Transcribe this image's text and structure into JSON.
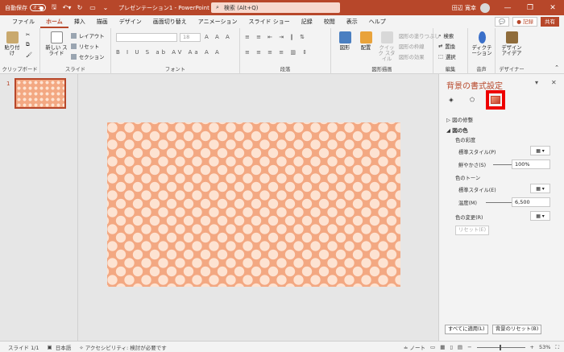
{
  "titlebar": {
    "autosave_label": "自動保存",
    "autosave_state": "オフ",
    "doc_title": "プレゼンテーション1 - PowerPoint",
    "search_placeholder": "検索 (Alt+Q)",
    "user_name": "田辺 寛幸"
  },
  "menu": {
    "tabs": [
      "ファイル",
      "ホーム",
      "挿入",
      "描画",
      "デザイン",
      "画面切り替え",
      "アニメーション",
      "スライド ショー",
      "記録",
      "校閲",
      "表示",
      "ヘルプ"
    ],
    "active": "ホーム",
    "record_label": "● 記録",
    "share_label": "共有"
  },
  "ribbon": {
    "clipboard": {
      "label": "クリップボード",
      "paste": "貼り付け"
    },
    "slides": {
      "label": "スライド",
      "new_slide": "新しい スライド",
      "layout": "レイアウト",
      "reset": "リセット",
      "section": "セクション"
    },
    "font": {
      "label": "フォント",
      "size": "18"
    },
    "paragraph": {
      "label": "段落"
    },
    "drawing": {
      "label": "図形描画",
      "shape": "図形",
      "arrange": "配置",
      "quick_style": "クイック スタイル",
      "fill": "図形の塗りつぶし",
      "outline": "図形の枠線",
      "effects": "図形の効果"
    },
    "editing": {
      "label": "編集",
      "find": "検索",
      "replace": "置換",
      "select": "選択"
    },
    "voice": {
      "label": "音声",
      "dictate": "ディクテーション"
    },
    "designer": {
      "label": "デザイナー",
      "ideas": "デザイン アイデア"
    }
  },
  "thumbs": {
    "slide_number": "1"
  },
  "pane": {
    "title": "背景の書式設定",
    "sec_picture_correction": "図の修整",
    "sec_picture_color": "図の色",
    "saturation": "色の彩度",
    "preset1": "標準スタイル(P)",
    "vividness": "鮮やかさ(S)",
    "vividness_value": "100%",
    "tone": "色のトーン",
    "preset2": "標準スタイル(E)",
    "temperature": "温度(M)",
    "temperature_value": "6,500",
    "recolor": "色の変更(R)",
    "reset": "リセット(E)",
    "apply_all": "すべてに適用(L)",
    "reset_bg": "背景のリセット(B)"
  },
  "status": {
    "slide": "スライド 1/1",
    "language": "日本語",
    "accessibility": "アクセシビリティ: 検討が必要です",
    "notes": "ノート",
    "zoom": "53%"
  },
  "colors": {
    "accent": "#b7472a",
    "pattern_bg": "#f3a882",
    "pattern_dot": "#fde3d2"
  }
}
